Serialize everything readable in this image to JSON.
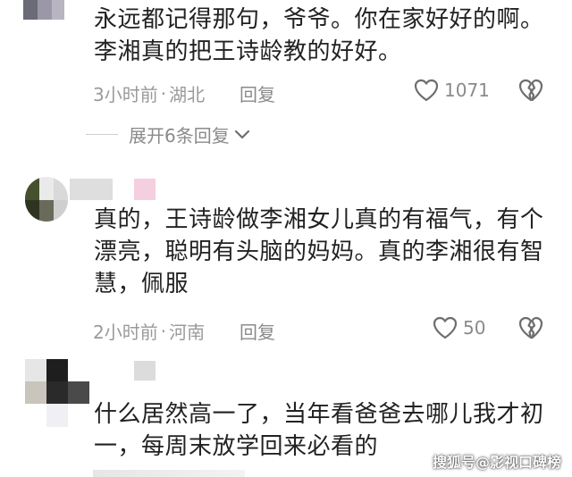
{
  "comments": [
    {
      "text_line1": "永远都记得那句，爷爷。你在家好好的啊。",
      "text_line2": "李湘真的把王诗龄教的好好。",
      "time": "3小时前",
      "location": "湖北",
      "reply_label": "回复",
      "likes": "1071",
      "expand_label": "展开6条回复"
    },
    {
      "text_line1": "真的，王诗龄做李湘女儿真的有福气，有个",
      "text_line2": "漂亮，聪明有头脑的妈妈。真的李湘很有智",
      "text_line3": "慧，佩服",
      "time": "2小时前",
      "location": "河南",
      "reply_label": "回复",
      "likes": "50"
    },
    {
      "text_line1": "什么居然高一了，当年看爸爸去哪儿我才初",
      "text_line2": "一，每周末放学回来必看的"
    }
  ],
  "separator": "·",
  "watermark": "搜狐号@影视口碑榜",
  "icons": {
    "like": "heart-outline-icon",
    "dislike": "broken-heart-icon",
    "expand": "chevron-down-icon"
  },
  "colors": {
    "text": "#222222",
    "meta": "#9a9a9a",
    "icon": "#6e6e6e"
  }
}
